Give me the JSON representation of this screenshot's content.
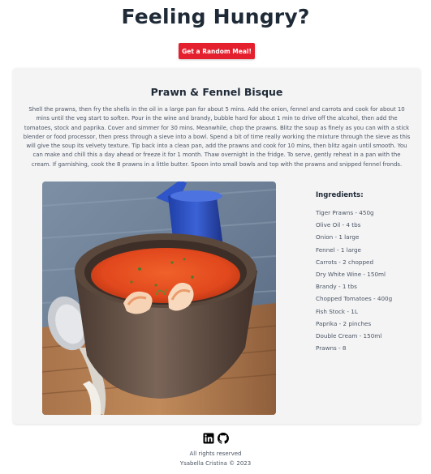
{
  "header": {
    "title": "Feeling Hungry?",
    "random_button_label": "Get a Random Meal!"
  },
  "meal": {
    "name": "Prawn & Fennel Bisque",
    "instructions": "Shell the prawns, then fry the shells in the oil in a large pan for about 5 mins. Add the onion, fennel and carrots and cook for about 10 mins until the veg start to soften. Pour in the wine and brandy, bubble hard for about 1 min to drive off the alcohol, then add the tomatoes, stock and paprika. Cover and simmer for 30 mins. Meanwhile, chop the prawns. Blitz the soup as finely as you can with a stick blender or food processor, then press through a sieve into a bowl. Spend a bit of time really working the mixture through the sieve as this will give the soup its velvety texture. Tip back into a clean pan, add the prawns and cook for 10 mins, then blitz again until smooth. You can make and chill this a day ahead or freeze it for 1 month. Thaw overnight in the fridge. To serve, gently reheat in a pan with the cream. If garnishing, cook the 8 prawns in a little butter. Spoon into small bowls and top with the prawns and snipped fennel fronds.",
    "ingredients_title": "Ingredients:",
    "ingredients": [
      "Tiger Prawns - 450g",
      "Olive Oil - 4 tbs",
      "Onion - 1 large",
      "Fennel - 1 large",
      "Carrots - 2 chopped",
      "Dry White Wine - 150ml",
      "Brandy - 1 tbs",
      "Chopped Tomatoes - 400g",
      "Fish Stock - 1L",
      "Paprika - 2 pinches",
      "Double Cream - 150ml",
      "Prawns - 8"
    ]
  },
  "footer": {
    "icons": [
      "linkedin-icon",
      "github-icon"
    ],
    "rights": "All rights reserved",
    "credit": "Ysabella Cristina © 2023"
  },
  "colors": {
    "accent_button": "#e5202e",
    "card_background": "#f4f4f5",
    "heading": "#1f2a37",
    "body_text": "#4b5563"
  }
}
